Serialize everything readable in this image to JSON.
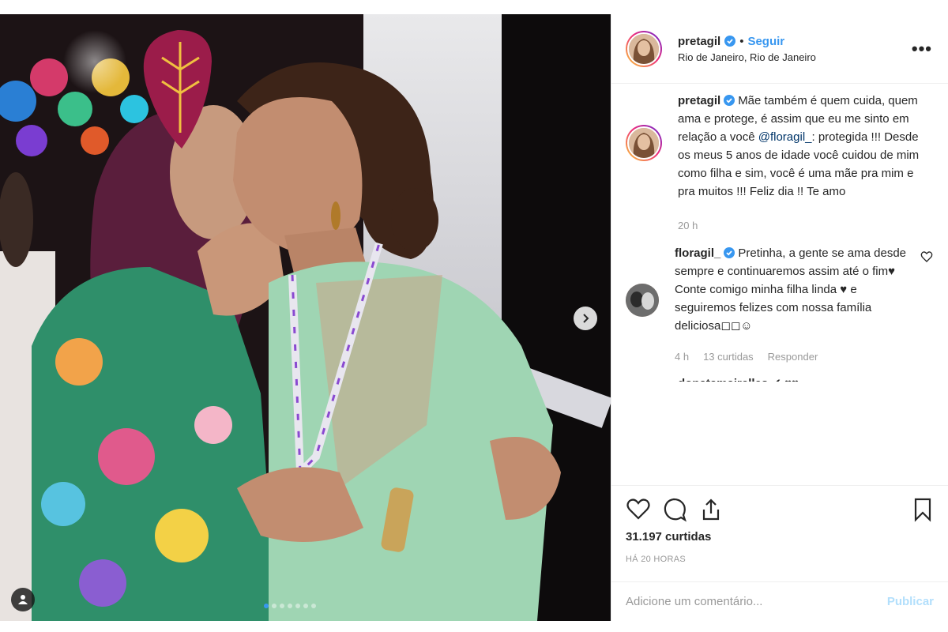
{
  "post": {
    "author": "pretagil",
    "follow_label": "Seguir",
    "separator": "•",
    "location": "Rio de Janeiro, Rio de Janeiro",
    "more_label": "•••",
    "image_alt": "Foto de pretagil",
    "carousel": {
      "total": 7,
      "active_index": 0
    }
  },
  "caption": {
    "username": "pretagil",
    "text_before": "Mãe também é quem cuida, quem ama e protege, é assim que eu me sinto em relação a você ",
    "mention": "@floragil_",
    "text_after": ": protegida !!! Desde os meus 5 anos de idade você cuidou de mim como filha e sim, você é uma mãe pra mim e pra muitos !!! Feliz dia !! Te amo",
    "time": "20 h"
  },
  "comments": [
    {
      "username": "floragil_",
      "text": "Pretinha, a gente se ama desde sempre e continuaremos assim até o fim♥ Conte comigo minha filha linda ♥ e seguiremos felizes com nossa família deliciosa◻◻☺",
      "time": "4 h",
      "likes": "13 curtidas",
      "reply_label": "Responder"
    }
  ],
  "partial_comment": "donatamairelles ✔ ♥♥",
  "likes": "31.197 curtidas",
  "timestamp": "HÁ 20 HORAS",
  "add_comment": {
    "placeholder": "Adicione um comentário...",
    "publish_label": "Publicar"
  },
  "colors": {
    "link": "#3897f0",
    "mention": "#003569",
    "muted": "#999999",
    "publish_disabled": "#b2dffc"
  },
  "icons": [
    "heart-icon",
    "comment-icon",
    "share-icon",
    "bookmark-icon",
    "verified-icon",
    "chevron-right-icon",
    "user-tag-icon"
  ]
}
